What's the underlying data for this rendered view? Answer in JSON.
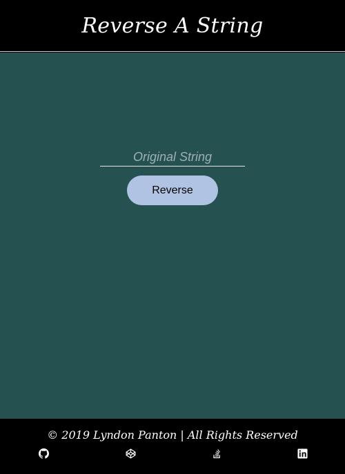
{
  "header": {
    "title": "Reverse A String"
  },
  "form": {
    "input_placeholder": "Original String",
    "input_value": "",
    "button_label": "Reverse"
  },
  "footer": {
    "copyright": "© 2019 Lyndon Panton | All Rights Reserved",
    "social_links": [
      {
        "icon": "github-icon"
      },
      {
        "icon": "codepen-icon"
      },
      {
        "icon": "stackoverflow-icon"
      },
      {
        "icon": "linkedin-icon"
      }
    ]
  },
  "colors": {
    "header_bg": "#000000",
    "main_bg": "#255250",
    "button_bg": "#b1c3e3",
    "footer_bg": "#000000",
    "text_light": "#ffffff"
  }
}
